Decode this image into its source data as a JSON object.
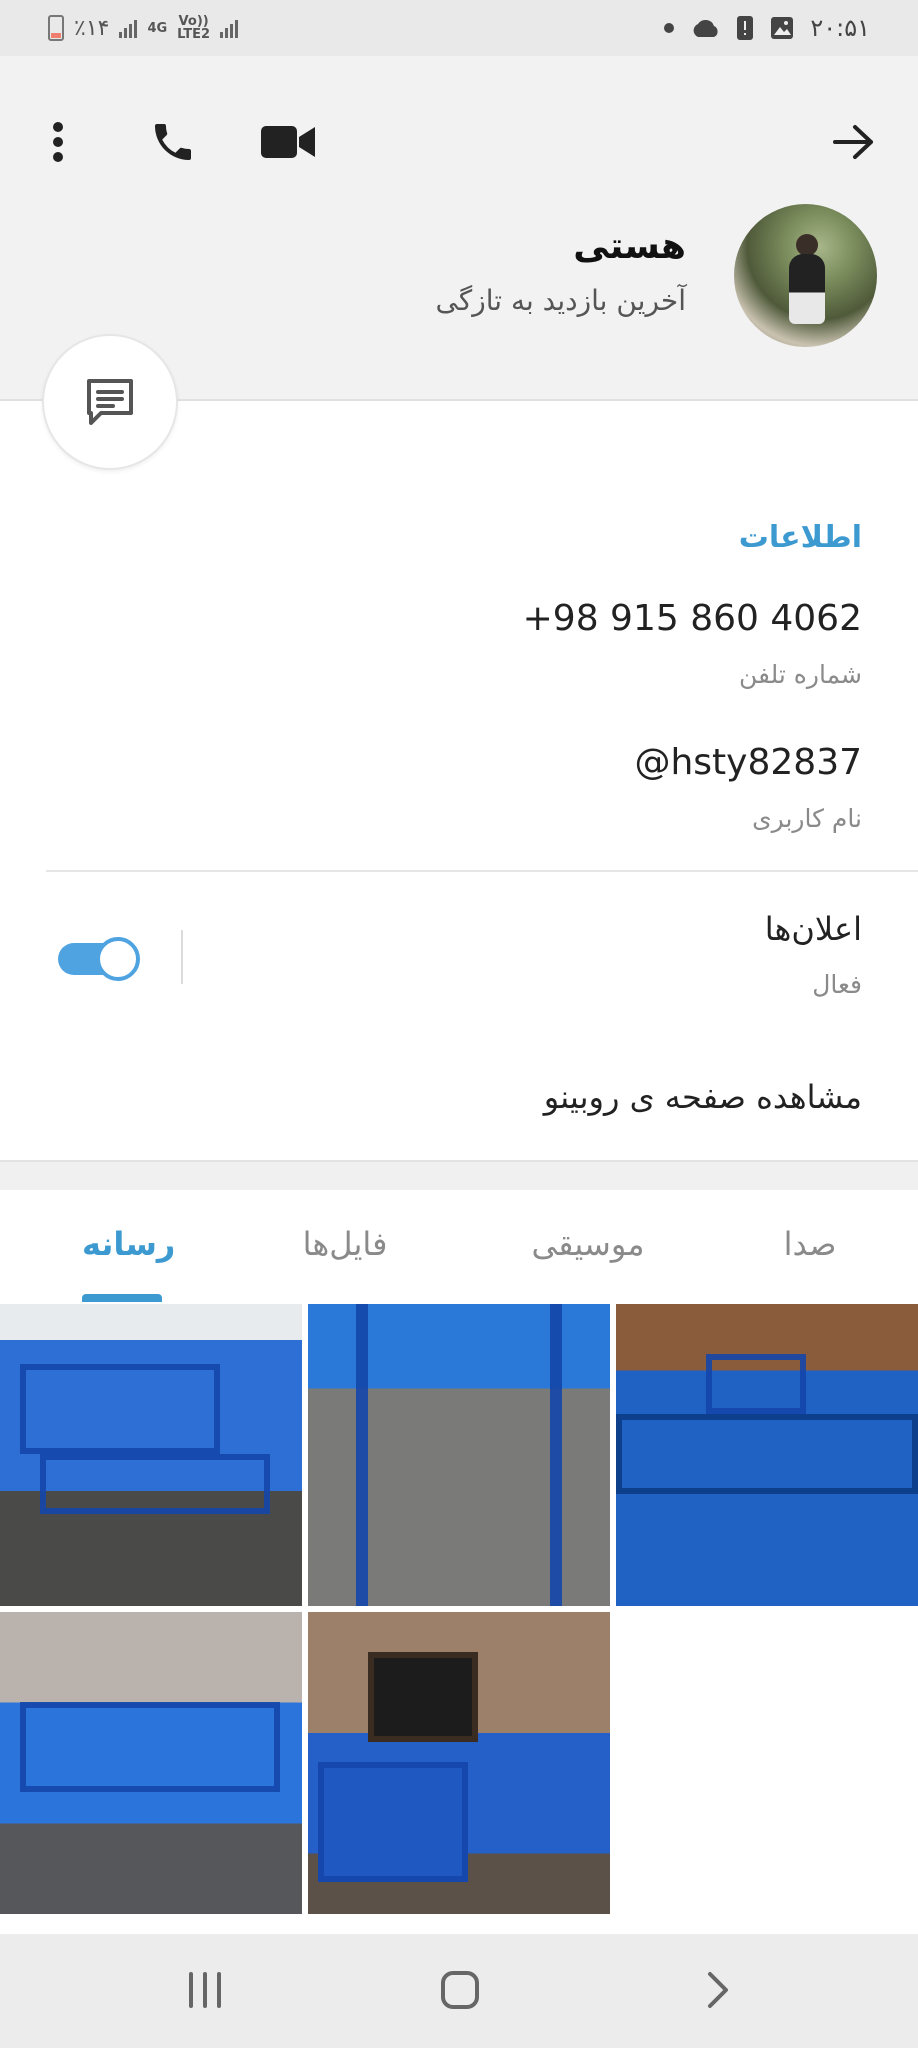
{
  "status_bar": {
    "time": "۲۰:۵۱",
    "battery": "٪۱۴",
    "network_top": "4G",
    "network_volte": "Vo))",
    "network_lte": "LTE2"
  },
  "header": {
    "name": "هستی",
    "last_seen": "آخرین بازدید به تازگی",
    "icons": [
      "back-arrow-icon",
      "video-call-icon",
      "phone-call-icon",
      "more-vertical-icon"
    ]
  },
  "info": {
    "section_title": "اطلاعات",
    "phone": "+98 915 860 4062",
    "phone_label": "شماره تلفن",
    "username": "@hsty82837",
    "username_label": "نام کاربری"
  },
  "notifications": {
    "title": "اعلان‌ها",
    "status": "فعال",
    "enabled": true
  },
  "rubino_link": "مشاهده صفحه ی روبینو",
  "tabs": [
    {
      "label": "رسانه",
      "active": true
    },
    {
      "label": "فایل‌ها",
      "active": false
    },
    {
      "label": "موسیقی",
      "active": false
    },
    {
      "label": "صدا",
      "active": false
    }
  ],
  "colors": {
    "accent": "#3c9ad1",
    "toggle": "#4fa3e0",
    "header_bg": "#f2f2f2"
  }
}
